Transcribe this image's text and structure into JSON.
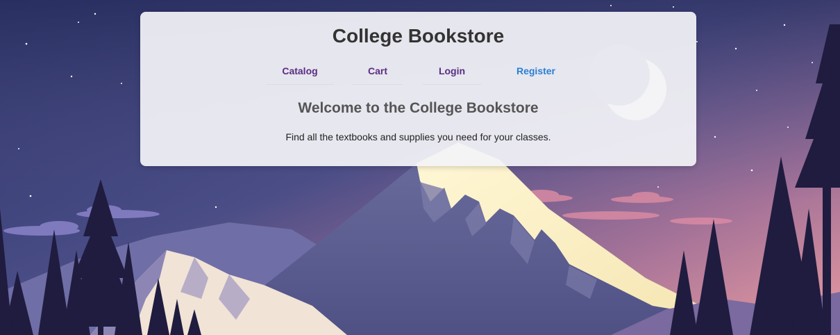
{
  "header": {
    "title": "College Bookstore"
  },
  "nav": {
    "items": [
      {
        "label": "Catalog"
      },
      {
        "label": "Cart"
      },
      {
        "label": "Login"
      },
      {
        "label": "Register"
      }
    ]
  },
  "main": {
    "heading": "Welcome to the College Bookstore",
    "description": "Find all the textbooks and supplies you need for your classes."
  },
  "colors": {
    "nav_link": "#5a2d82",
    "nav_link_active": "#2a7fd4",
    "title": "#333333",
    "card_background": "#f3f3f8"
  },
  "background": {
    "scene": "night mountain landscape with crescent moon, stars and pine trees"
  }
}
